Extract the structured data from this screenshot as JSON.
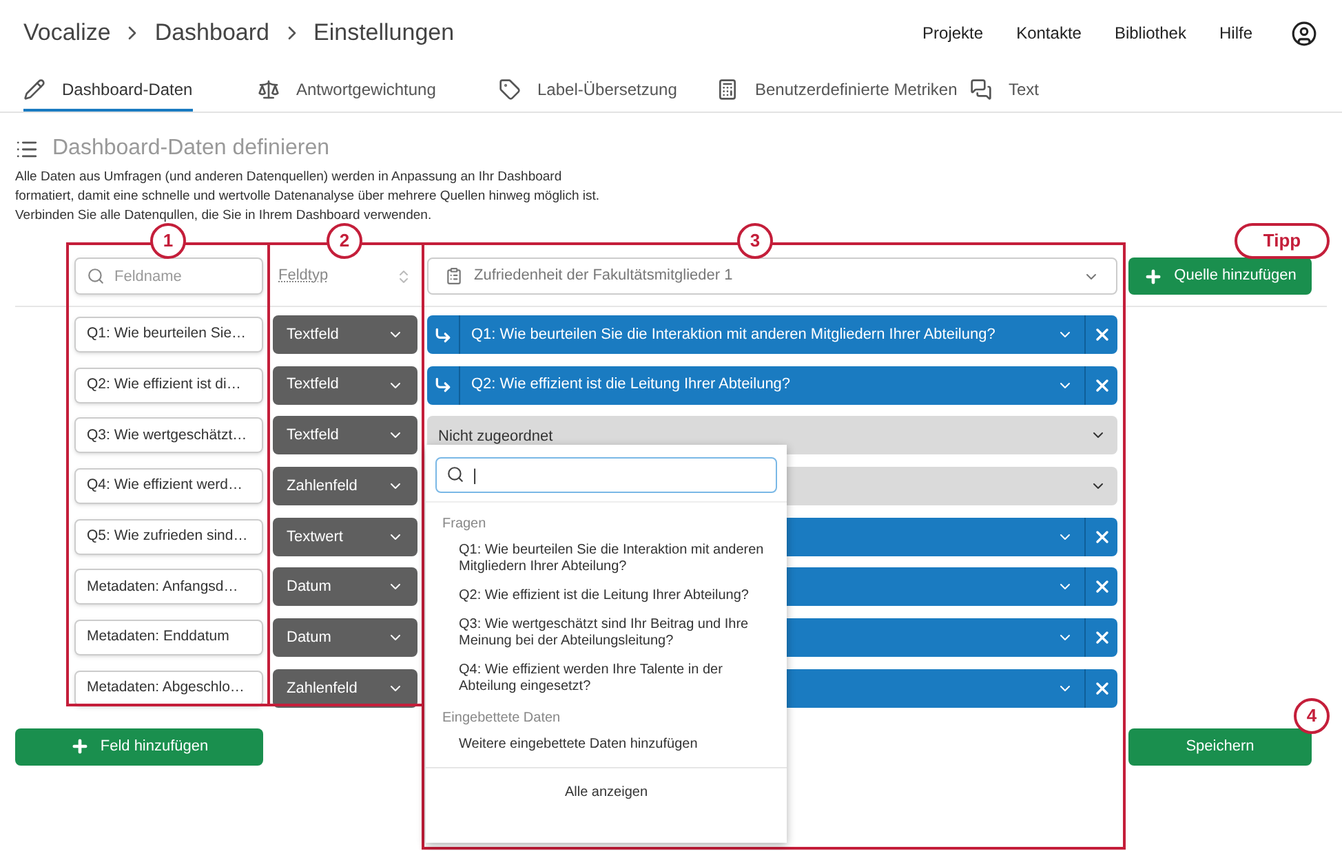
{
  "breadcrumb": [
    "Vocalize",
    "Dashboard",
    "Einstellungen"
  ],
  "top_nav": [
    "Projekte",
    "Kontakte",
    "Bibliothek",
    "Hilfe"
  ],
  "tabs": [
    {
      "label": "Dashboard-Daten",
      "selected": true
    },
    {
      "label": "Antwortgewichtung",
      "selected": false
    },
    {
      "label": "Label-Übersetzung",
      "selected": false
    },
    {
      "label": "Benutzerdefinierte Metriken",
      "selected": false
    },
    {
      "label": "Text",
      "selected": false
    }
  ],
  "section": {
    "title": "Dashboard-Daten definieren",
    "description": [
      "Alle Daten aus Umfragen (und anderen Datenquellen) werden in Anpassung an Ihr Dashboard",
      "formatiert, damit eine schnelle und wertvolle Datenanalyse über mehrere Quellen hinweg möglich ist.",
      "Verbinden Sie alle Datenqullen, die Sie in Ihrem Dashboard verwenden."
    ]
  },
  "field_search": {
    "placeholder": "Feldname"
  },
  "field_type_header": "Feldtyp",
  "source_select": "Zufriedenheit der Fakultätsmitglieder 1",
  "add_source_button": "Quelle hinzufügen",
  "rows": [
    {
      "field": "Q1: Wie beurteilen Sie…",
      "type": "Textfeld",
      "mapping": {
        "kind": "mapped",
        "label": "Q1: Wie beurteilen Sie die Interaktion mit anderen Mitgliedern Ihrer Abteilung?"
      }
    },
    {
      "field": "Q2: Wie effizient ist di…",
      "type": "Textfeld",
      "mapping": {
        "kind": "mapped",
        "label": "Q2: Wie effizient ist die Leitung Ihrer Abteilung?"
      }
    },
    {
      "field": "Q3: Wie wertgeschätzt…",
      "type": "Textfeld",
      "mapping": {
        "kind": "unmapped",
        "label": "Nicht zugeordnet"
      }
    },
    {
      "field": "Q4: Wie effizient werd…",
      "type": "Zahlenfeld",
      "mapping": {
        "kind": "unmapped"
      }
    },
    {
      "field": "Q5: Wie zufrieden sind…",
      "type": "Textwert",
      "mapping": {
        "kind": "mapped"
      }
    },
    {
      "field": "Metadaten: Anfangsd…",
      "type": "Datum",
      "mapping": {
        "kind": "mapped"
      }
    },
    {
      "field": "Metadaten: Enddatum",
      "type": "Datum",
      "mapping": {
        "kind": "mapped"
      }
    },
    {
      "field": "Metadaten: Abgeschlo…",
      "type": "Zahlenfeld",
      "mapping": {
        "kind": "mapped"
      }
    }
  ],
  "add_field_button": "Feld hinzufügen",
  "save_button": "Speichern",
  "dropdown": {
    "search_value": "|",
    "groups": [
      {
        "title": "Fragen",
        "items": [
          "Q1: Wie beurteilen Sie die Interaktion mit anderen Mitgliedern Ihrer Abteilung?",
          "Q2: Wie effizient ist die Leitung Ihrer Abteilung?",
          "Q3: Wie wertgeschätzt sind Ihr Beitrag und Ihre Meinung bei der Abteilungsleitung?",
          "Q4: Wie effizient werden Ihre Talente in der Abteilung eingesetzt?"
        ]
      },
      {
        "title": "Eingebettete Daten",
        "items": [
          "Weitere eingebettete Daten hinzufügen"
        ]
      }
    ],
    "footer": "Alle anzeigen"
  },
  "annotations": {
    "markers": [
      "1",
      "2",
      "3",
      "4"
    ],
    "tip": "Tipp"
  }
}
